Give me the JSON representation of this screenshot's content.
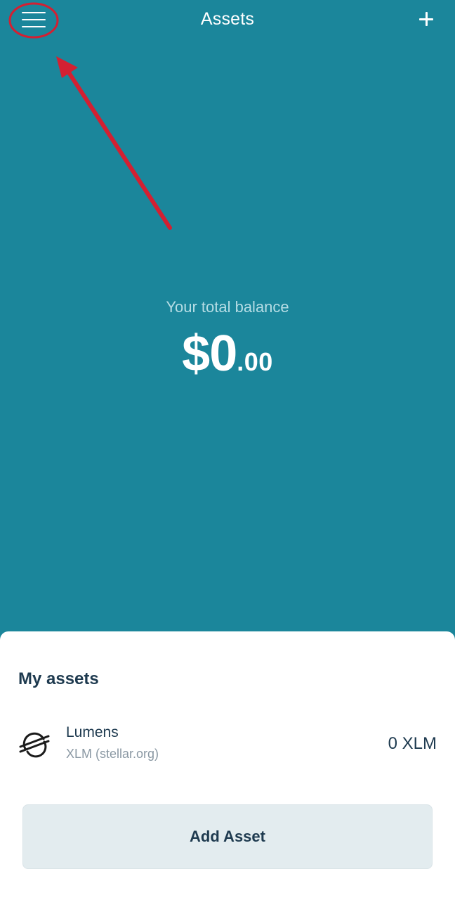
{
  "header": {
    "title": "Assets",
    "menu_icon": "hamburger-menu-icon",
    "add_icon": "plus-icon"
  },
  "balance": {
    "label": "Your total balance",
    "amount_main": "$0",
    "amount_cents": ".00"
  },
  "assets": {
    "section_title": "My assets",
    "items": [
      {
        "name": "Lumens",
        "subtitle": "XLM (stellar.org)",
        "balance": "0 XLM",
        "icon": "stellar-logo-icon"
      }
    ],
    "add_button_label": "Add Asset"
  },
  "colors": {
    "background": "#1b869b",
    "sheet": "#ffffff",
    "text_dark": "#1e3a4f",
    "text_muted": "#8a98a3",
    "button_bg": "#e3ecef",
    "annotation_red": "#d32032"
  }
}
